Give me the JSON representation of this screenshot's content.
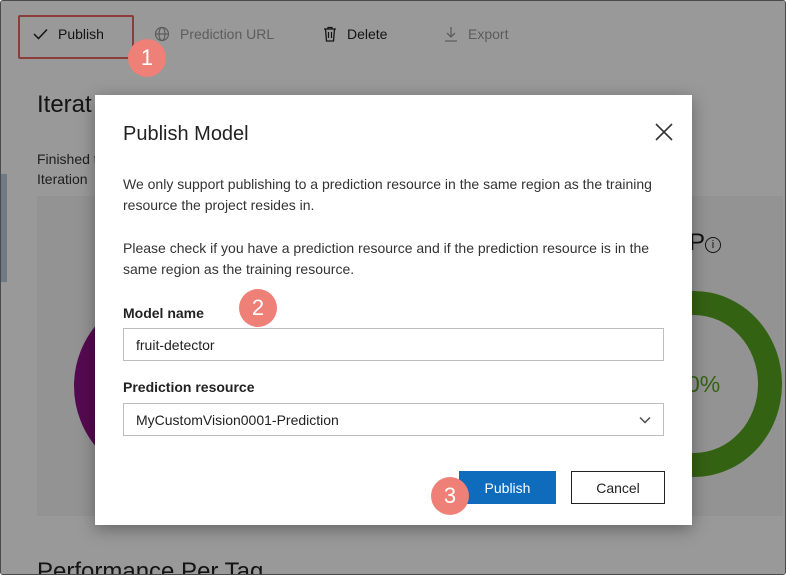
{
  "toolbar": {
    "publish_label": "Publish",
    "prediction_url_label": "Prediction URL",
    "delete_label": "Delete",
    "export_label": "Export"
  },
  "background": {
    "heading": "Iterat",
    "finished_text": "Finished t",
    "iteration_text": "Iteration",
    "percent": "0%",
    "partial_letter": "P",
    "info": "i",
    "bottom_heading": "Performance Per Tag"
  },
  "callouts": [
    "1",
    "2",
    "3"
  ],
  "dialog": {
    "title": "Publish Model",
    "paragraph1": "We only support publishing to a prediction resource in the same region as the training resource the project resides in.",
    "paragraph2": "Please check if you have a prediction resource and if the prediction resource is in the same region as the training resource.",
    "model_name_label": "Model name",
    "model_name_value": "fruit-detector",
    "prediction_resource_label": "Prediction resource",
    "prediction_resource_value": "MyCustomVision0001-Prediction",
    "publish_button": "Publish",
    "cancel_button": "Cancel"
  },
  "colors": {
    "accent": "#0f6cbd",
    "callout": "#ee8077",
    "highlight": "#e7685c",
    "donut_left": "#8e1187",
    "donut_right": "#57a321"
  },
  "icons": {
    "publish": "checkmark-icon",
    "prediction_url": "globe-icon",
    "delete": "trash-icon",
    "export": "download-icon",
    "close": "close-icon",
    "select": "chevron-down-icon"
  }
}
